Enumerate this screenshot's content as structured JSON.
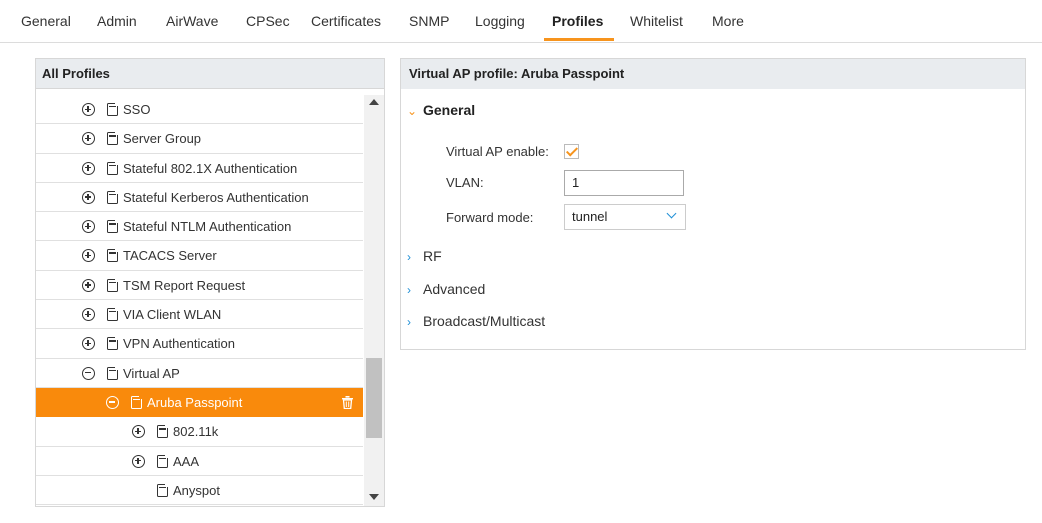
{
  "nav": {
    "tabs": [
      "General",
      "Admin",
      "AirWave",
      "CPSec",
      "Certificates",
      "SNMP",
      "Logging",
      "Profiles",
      "Whitelist",
      "More"
    ],
    "active": "Profiles",
    "accent": "#f7941d"
  },
  "left_panel": {
    "title": "All Profiles",
    "rows": [
      {
        "label": "SSO",
        "expander": "plus"
      },
      {
        "label": "Server Group",
        "expander": "plus"
      },
      {
        "label": "Stateful 802.1X Authentication",
        "expander": "plus"
      },
      {
        "label": "Stateful Kerberos Authentication",
        "expander": "plus"
      },
      {
        "label": "Stateful NTLM Authentication",
        "expander": "plus"
      },
      {
        "label": "TACACS Server",
        "expander": "plus"
      },
      {
        "label": "TSM Report Request",
        "expander": "plus"
      },
      {
        "label": "VIA Client WLAN",
        "expander": "plus"
      },
      {
        "label": "VPN Authentication",
        "expander": "plus"
      },
      {
        "label": "Virtual AP",
        "expander": "minus"
      },
      {
        "label": "Aruba Passpoint",
        "expander": "minus",
        "selected": true
      },
      {
        "label": "802.11k",
        "expander": "plus"
      },
      {
        "label": "AAA",
        "expander": "plus"
      },
      {
        "label": "Anyspot",
        "expander": "none"
      }
    ],
    "selected_color": "#f98a0c"
  },
  "right_panel": {
    "title": "Virtual AP profile: Aruba Passpoint",
    "sections": {
      "general": "General",
      "rf": "RF",
      "advanced": "Advanced",
      "broadcast": "Broadcast/Multicast"
    },
    "fields": {
      "virtual_ap_enable_label": "Virtual AP enable:",
      "virtual_ap_enable_checked": true,
      "vlan_label": "VLAN:",
      "vlan_value": "1",
      "forward_mode_label": "Forward mode:",
      "forward_mode_value": "tunnel"
    }
  }
}
